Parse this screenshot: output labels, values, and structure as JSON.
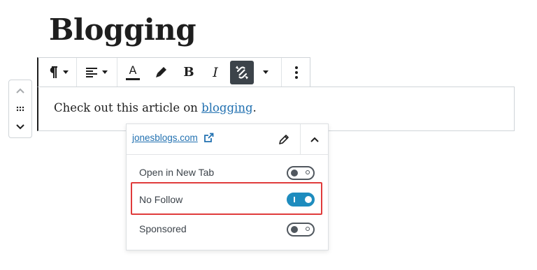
{
  "page": {
    "title": "Blogging"
  },
  "toolbar": {
    "paragraph_icon": "paragraph-icon",
    "align_icon": "align-left-icon",
    "text_color_icon": "text-color-icon",
    "text_color_letter": "A",
    "highlight_icon": "highlighter-icon",
    "bold_label": "B",
    "italic_label": "I",
    "unlink_icon": "unlink-icon",
    "more_rich_text_icon": "chevron-down-icon",
    "options_icon": "more-vertical-icon"
  },
  "mover": {
    "up_icon": "chevron-up-icon",
    "drag_icon": "drag-handle-icon",
    "down_icon": "chevron-down-icon"
  },
  "paragraph": {
    "text_before": "Check out this article on ",
    "link_text": "blogging",
    "text_after": "."
  },
  "link_popover": {
    "url": "jonesblogs.com",
    "external_icon": "external-link-icon",
    "edit_icon": "pencil-icon",
    "collapse_icon": "chevron-up-icon",
    "options": [
      {
        "label": "Open in New Tab",
        "checked": false
      },
      {
        "label": "No Follow",
        "checked": true
      },
      {
        "label": "Sponsored",
        "checked": false
      }
    ]
  },
  "colors": {
    "accent": "#1e8cbe",
    "link": "#2271b1",
    "highlight_border": "#e03b3b",
    "unlink_bg": "#3c434a"
  }
}
